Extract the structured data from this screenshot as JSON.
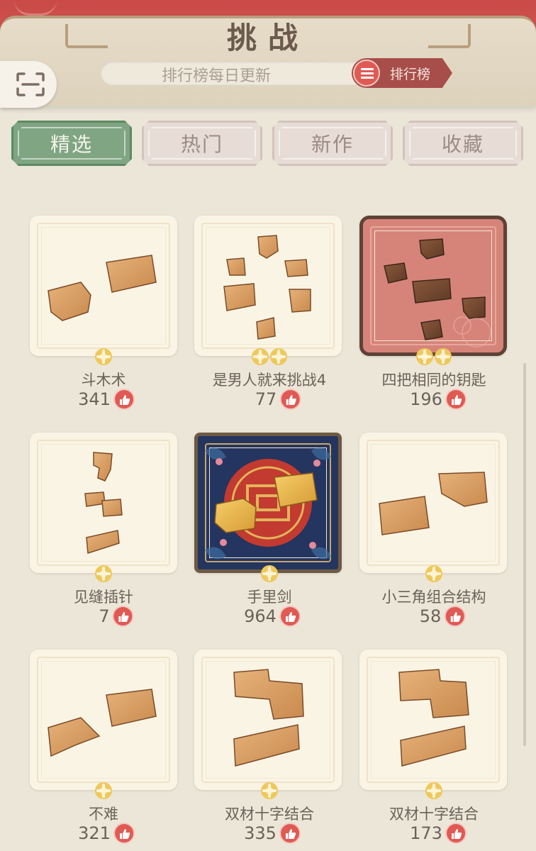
{
  "header": {
    "title": "挑战",
    "rank_notice": "排行榜每日更新",
    "rank_button_label": "排行榜"
  },
  "tabs": [
    {
      "label": "精选",
      "active": true
    },
    {
      "label": "热门",
      "active": false
    },
    {
      "label": "新作",
      "active": false
    },
    {
      "label": "收藏",
      "active": false
    }
  ],
  "puzzles": [
    {
      "title": "斗木术",
      "likes": "341",
      "difficulty": 1,
      "style": "plain"
    },
    {
      "title": "是男人就来挑战4",
      "likes": "77",
      "difficulty": 2,
      "style": "plain"
    },
    {
      "title": "四把相同的钥匙",
      "likes": "196",
      "difficulty": 2,
      "style": "selected"
    },
    {
      "title": "见缝插针",
      "likes": "7",
      "difficulty": 1,
      "style": "plain"
    },
    {
      "title": "手里剑",
      "likes": "964",
      "difficulty": 1,
      "style": "special"
    },
    {
      "title": "小三角组合结构",
      "likes": "58",
      "difficulty": 1,
      "style": "plain"
    },
    {
      "title": "不难",
      "likes": "321",
      "difficulty": 1,
      "style": "plain"
    },
    {
      "title": "双材十字结合",
      "likes": "335",
      "difficulty": 1,
      "style": "plain"
    },
    {
      "title": "双材十字结合",
      "likes": "173",
      "difficulty": 1,
      "style": "plain"
    }
  ],
  "icons": {
    "scan": "scan-icon",
    "rank_list": "list-icon",
    "difficulty": "flower-icon",
    "like": "thumbs-up-icon"
  },
  "colors": {
    "accent_red": "#e05a54",
    "active_tab_green": "#7fa582",
    "wood": "#d79a5c"
  }
}
